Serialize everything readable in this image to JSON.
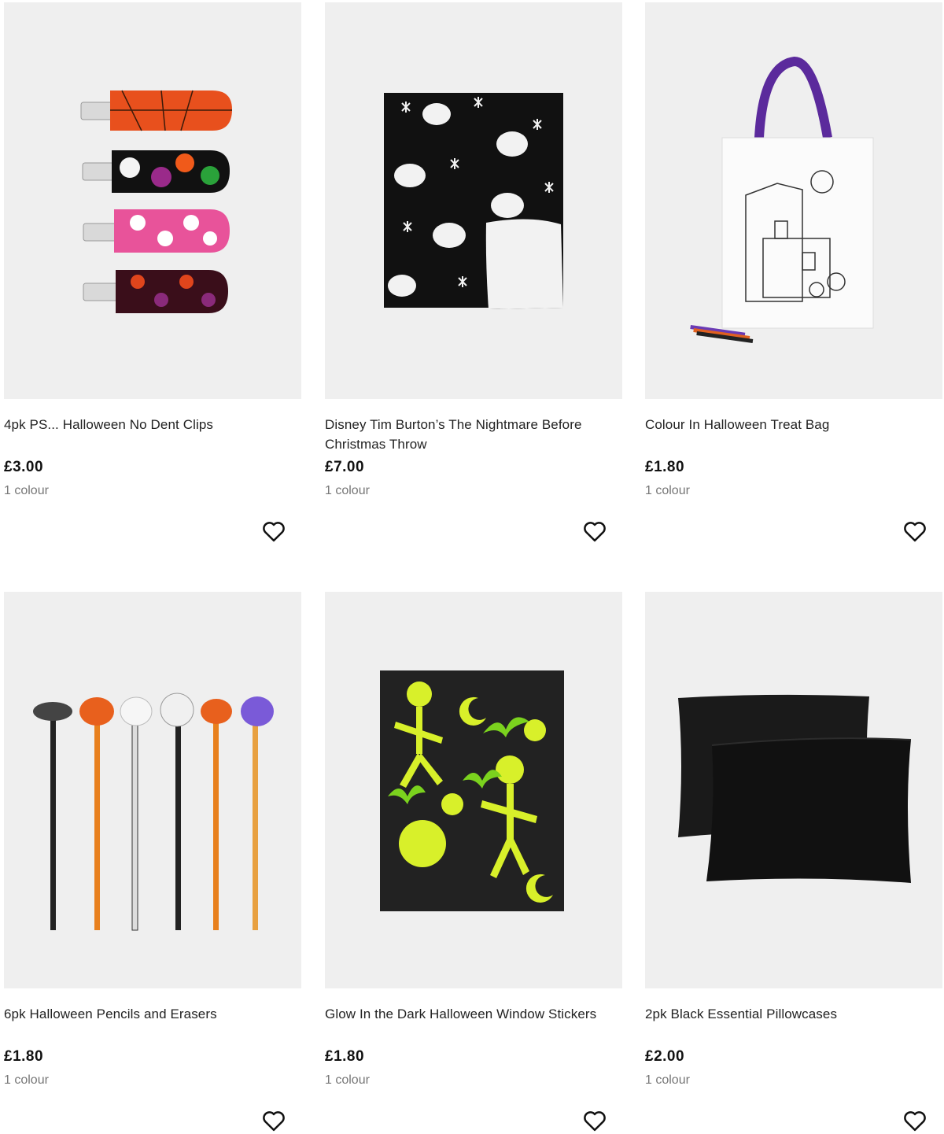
{
  "products": [
    {
      "title": "4pk PS... Halloween No Dent Clips",
      "price": "£3.00",
      "colours": "1 colour",
      "favourite_icon": "heart-outline-icon"
    },
    {
      "title": "Disney Tim Burton’s The Nightmare Before Christmas Throw",
      "price": "£7.00",
      "colours": "1 colour",
      "favourite_icon": "heart-outline-icon"
    },
    {
      "title": "Colour In Halloween Treat Bag",
      "price": "£1.80",
      "colours": "1 colour",
      "favourite_icon": "heart-outline-icon"
    },
    {
      "title": "6pk Halloween Pencils and Erasers",
      "price": "£1.80",
      "colours": "1 colour",
      "favourite_icon": "heart-outline-icon"
    },
    {
      "title": "Glow In the Dark Halloween Window Stickers",
      "price": "£1.80",
      "colours": "1 colour",
      "favourite_icon": "heart-outline-icon"
    },
    {
      "title": "2pk Black Essential Pillowcases",
      "price": "£2.00",
      "colours": "1 colour",
      "favourite_icon": "heart-outline-icon"
    }
  ],
  "colors": {
    "image_background": "#efefef",
    "text": "#222222",
    "muted_text": "#777777"
  }
}
